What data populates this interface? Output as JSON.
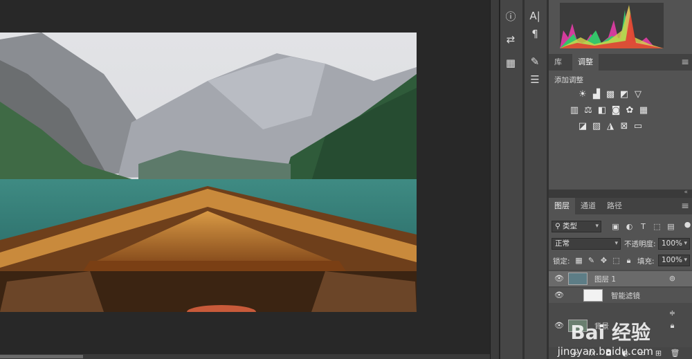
{
  "panels": {
    "library_tab": "库",
    "adjustments_tab": "调整",
    "add_adjustment": "添加调整",
    "layers_tab": "图层",
    "channels_tab": "通道",
    "paths_tab": "路径",
    "filter_kind": "类型",
    "blend_mode": "正常",
    "opacity_label": "不透明度:",
    "opacity_value": "100%",
    "lock_label": "锁定:",
    "fill_label": "填充:",
    "fill_value": "100%"
  },
  "layers": [
    {
      "name": "图层 1",
      "visible": true,
      "smart": true
    },
    {
      "name": "智能滤镜",
      "visible": true
    },
    {
      "name": "背景",
      "visible": true,
      "locked": true
    }
  ],
  "watermark": {
    "text": "Bai 经验",
    "url": "jingyan.baidu.com"
  },
  "colors": {
    "panel": "#535353",
    "canvas_bg": "#282828",
    "tab_bar": "#424242"
  }
}
